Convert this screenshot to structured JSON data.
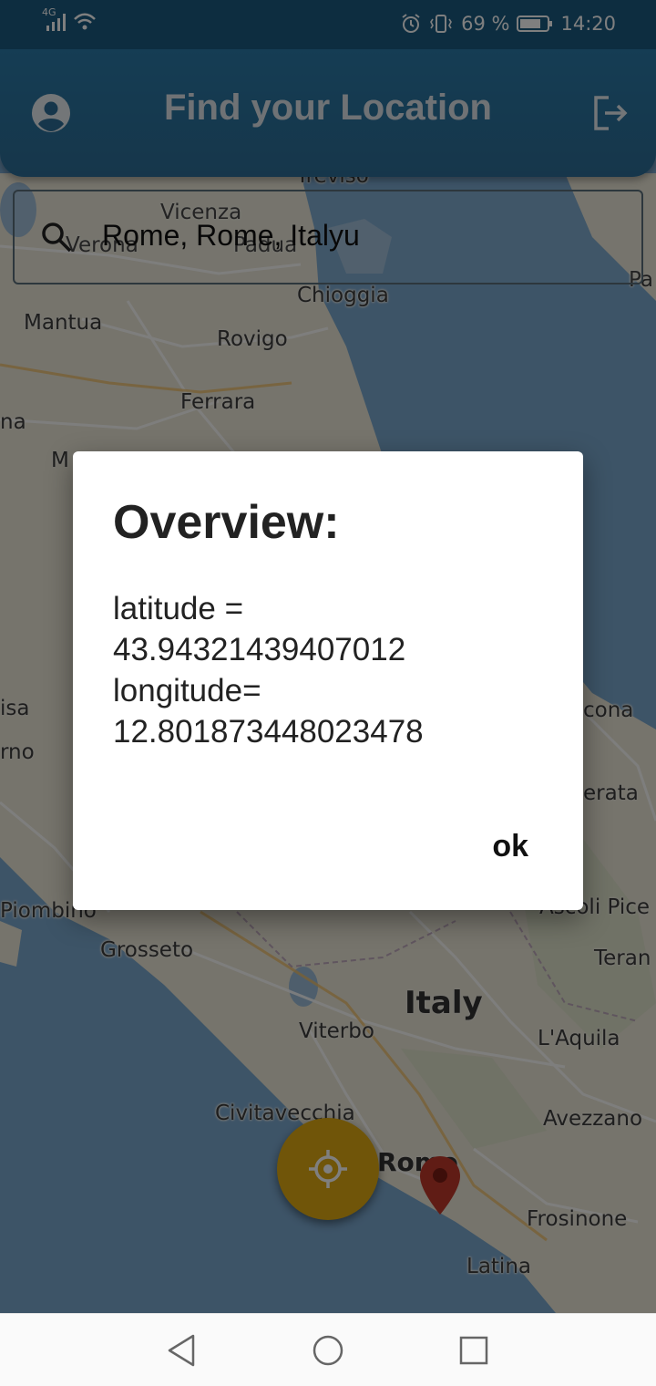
{
  "status_bar": {
    "network": "4G",
    "battery_percent": "69 %",
    "time": "14:20",
    "icons": [
      "signal-icon",
      "wifi-icon",
      "alarm-icon",
      "vibrate-icon",
      "battery-icon"
    ]
  },
  "app_bar": {
    "title": "Find your Location",
    "left_icon": "account-circle-icon",
    "right_icon": "logout-icon"
  },
  "search": {
    "value": "Rome, Rome, Italyu",
    "icon": "search-icon"
  },
  "map": {
    "labels": [
      "Treviso",
      "Vicenza",
      "Verona",
      "Padua",
      "Chioggia",
      "Mantua",
      "Rovigo",
      "Ferrara",
      "Pa",
      "na",
      "M",
      "isa",
      "rno",
      "cona",
      "erata",
      "Piombino",
      "Grosseto",
      "Ascoli Pice",
      "Teran",
      "Italy",
      "Viterbo",
      "L'Aquila",
      "Civitavecchia",
      "Avezzano",
      "Rome",
      "Frosinone",
      "Latina"
    ],
    "colors": {
      "sea": "#7ba8cf",
      "land": "#ece8d8",
      "roads": "#ffffff"
    }
  },
  "dialog": {
    "title": "Overview:",
    "latitude_label": "latitude =",
    "latitude_value": "43.94321439407012",
    "longitude_label": "longitude=",
    "longitude_value": "12.801873448023478",
    "ok_label": "ok"
  },
  "fab": {
    "icon": "gps-fixed-icon",
    "color": "#e0aa12"
  },
  "marker": {
    "icon": "location-pin-icon",
    "color": "#c0392b"
  },
  "nav_bar": {
    "buttons": [
      "back-icon",
      "home-icon",
      "recents-icon"
    ]
  }
}
